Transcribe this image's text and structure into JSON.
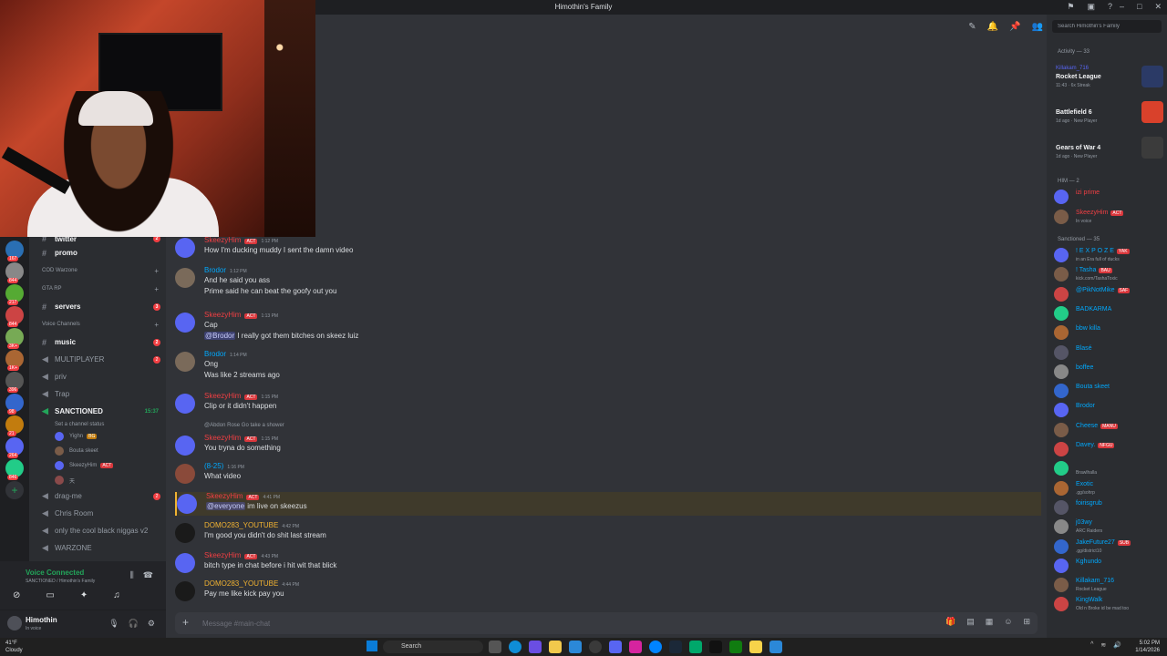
{
  "window": {
    "title": "Himothin's Family"
  },
  "chat_tools": [
    "pin-icon",
    "bell-icon",
    "threads-icon",
    "members-icon"
  ],
  "channels": [
    {
      "label": "twitter",
      "kind": "text",
      "unread": "2"
    },
    {
      "label": "promo",
      "kind": "text",
      "unread": ""
    }
  ],
  "categories": {
    "cod": "COD Warzone",
    "gta": "GTA RP",
    "voice": "Voice Channels"
  },
  "channels2": [
    {
      "label": "servers",
      "kind": "text",
      "unread": "3"
    },
    {
      "label": "music",
      "kind": "text",
      "unread": "2"
    },
    {
      "label": "MULTIPLAYER",
      "kind": "voice",
      "unread": "2"
    },
    {
      "label": "priv",
      "kind": "voice",
      "unread": ""
    },
    {
      "label": "Trap",
      "kind": "voice",
      "unread": ""
    },
    {
      "label": "SANCTIONED",
      "kind": "voice",
      "time": "15:37"
    }
  ],
  "sanctioned": {
    "status_prompt": "Set a channel status",
    "users": [
      {
        "name": "Yighn",
        "tag": "BG"
      },
      {
        "name": "Bouta skeet",
        "tag": ""
      },
      {
        "name": "SkeezyHim",
        "tag": "ACT"
      },
      {
        "name": "天",
        "tag": ""
      }
    ]
  },
  "channels3": [
    {
      "label": "drag-me",
      "unread": "2"
    },
    {
      "label": "Chris Room",
      "unread": ""
    },
    {
      "label": "only the cool black niggas v2",
      "unread": ""
    },
    {
      "label": "WARZONE",
      "unread": ""
    }
  ],
  "voice_panel": {
    "status": "Voice Connected",
    "location": "SANCTIONED / Himothin's Family"
  },
  "user_panel": {
    "name": "Himothin",
    "status": "In voice"
  },
  "server_badges": [
    "167",
    "844",
    "217",
    "844",
    "3K+",
    "1K+",
    "396",
    "98",
    "21",
    "264",
    "846"
  ],
  "messages": [
    {
      "author": "SkeezyHim",
      "tag": "ACT",
      "time": "1:12 PM",
      "lines": [
        "How I'm ducking muddy I sent the damn video"
      ]
    },
    {
      "author": "Brodor",
      "tag": "",
      "time": "1:12 PM",
      "lines": [
        "And he said you ass",
        "Prime said he can beat the goofy out you"
      ]
    },
    {
      "author": "SkeezyHim",
      "tag": "ACT",
      "time": "1:13 PM",
      "lines": [
        "Cap",
        "@Brodor I really got them bitches on skeez luiz"
      ]
    },
    {
      "author": "Brodor",
      "tag": "",
      "time": "1:14 PM",
      "lines": [
        "Ong",
        "Was like 2 streams ago"
      ]
    },
    {
      "author": "SkeezyHim",
      "tag": "ACT",
      "time": "1:15 PM",
      "lines": [
        "Clip or it didn't happen"
      ]
    },
    {
      "author": "SkeezyHim",
      "tag": "ACT",
      "time": "1:15 PM",
      "reply": "@Abdon Rose Go take a shower",
      "lines": [
        "You tryna do something"
      ]
    },
    {
      "author": "(8-25)",
      "tag": "",
      "time": "1:16 PM",
      "lines": [
        "What video"
      ]
    },
    {
      "author": "SkeezyHim",
      "tag": "ACT",
      "time": "4:41 PM",
      "lines": [
        "@everyone im live on skeezus"
      ]
    },
    {
      "author": "DOMO283_YOUTUBE",
      "tag": "",
      "time": "4:42 PM",
      "lines": [
        "I'm good you didn't do shit last stream"
      ]
    },
    {
      "author": "SkeezyHim",
      "tag": "ACT",
      "time": "4:43 PM",
      "lines": [
        "bitch type in chat before i hit wit that blick"
      ]
    },
    {
      "author": "DOMO283_YOUTUBE",
      "tag": "",
      "time": "4:44 PM",
      "lines": [
        "Pay me like kick pay you"
      ]
    }
  ],
  "composer": {
    "placeholder": "Message #main-chat"
  },
  "members": {
    "search_placeholder": "Search Himothin's Family",
    "activity_header": "Activity — 33",
    "activities": [
      {
        "who": "Killakam_716",
        "game": "Rocket League",
        "meta": "11:43 · 6x Streak"
      },
      {
        "who": "",
        "game": "Battlefield 6",
        "meta": "1d ago · New Player"
      },
      {
        "who": "",
        "game": "Gears of War 4",
        "meta": "1d ago · New Player"
      }
    ],
    "him_header": "HIM — 2",
    "him": [
      {
        "name": "izi prime",
        "status": "",
        "tag": ""
      },
      {
        "name": "SkeezyHim",
        "status": "In voice",
        "tag": "ACT"
      }
    ],
    "sanctioned_header": "Sanctioned — 35",
    "sanctioned": [
      {
        "name": "! E X P O Z E",
        "status": "in an Era full of ducks",
        "tag": "YAK"
      },
      {
        "name": "! Tasha",
        "status": "kick.com/TashaToxic",
        "tag": "BAU"
      },
      {
        "name": "@PikNotMike",
        "status": "",
        "tag": "SAF"
      },
      {
        "name": "BADKARMA",
        "status": "",
        "tag": ""
      },
      {
        "name": "bbw killa",
        "status": "",
        "tag": ""
      },
      {
        "name": "Blasé",
        "status": "",
        "tag": ""
      },
      {
        "name": "boffee",
        "status": "",
        "tag": ""
      },
      {
        "name": "Bouta skeet",
        "status": "",
        "tag": ""
      },
      {
        "name": "Brodor",
        "status": "",
        "tag": ""
      },
      {
        "name": "Cheese",
        "status": "",
        "tag": "MANU"
      },
      {
        "name": "Davey.",
        "status": "",
        "tag": "NFGU"
      },
      {
        "name": "",
        "status": "Brawlhalla",
        "tag": ""
      },
      {
        "name": "Exotic",
        "status": ".gg/sohrp",
        "tag": ""
      },
      {
        "name": "foirisgrub",
        "status": "",
        "tag": ""
      },
      {
        "name": "j03wy",
        "status": "ARC Raiders",
        "tag": ""
      },
      {
        "name": "JakeFuture27",
        "status": ".gg/district10",
        "tag": "SUB"
      },
      {
        "name": "Kghundo",
        "status": "",
        "tag": ""
      },
      {
        "name": "Killakam_716",
        "status": "Rocket League",
        "tag": ""
      },
      {
        "name": "KingWalk",
        "status": "Old n Broke id be mad too",
        "tag": ""
      }
    ]
  },
  "taskbar": {
    "weather_temp": "41°F",
    "weather_desc": "Cloudy",
    "search_label": "Search",
    "time": "5:02 PM",
    "date": "1/14/2026"
  }
}
